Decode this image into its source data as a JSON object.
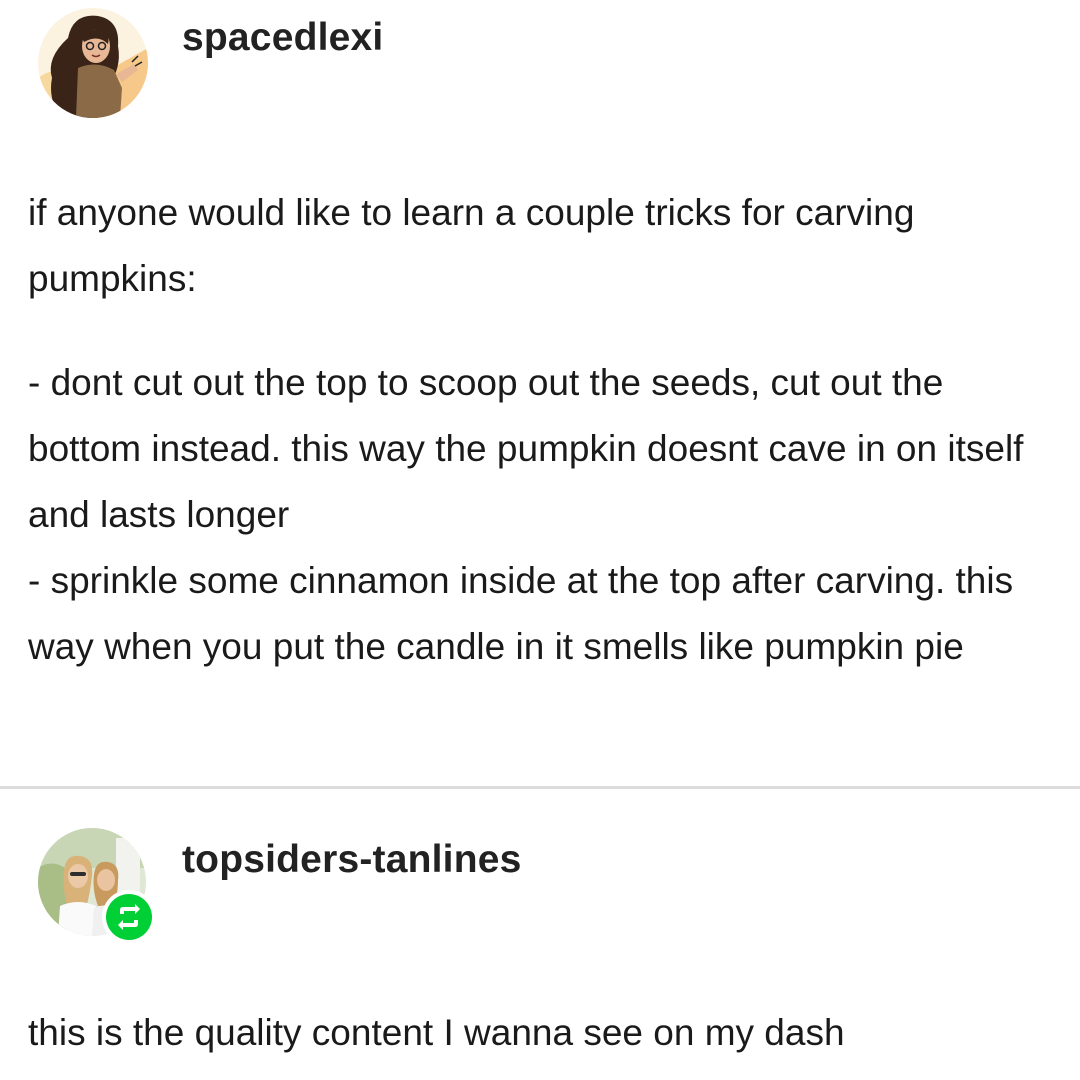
{
  "posts": [
    {
      "username": "spacedlexi",
      "avatar": "illustrated-woman-avatar",
      "intro": "if anyone would like to learn a couple tricks for carving pumpkins:",
      "tips": [
        "- dont cut out the top to scoop out the seeds, cut out the bottom instead. this way the pumpkin doesnt cave in on itself and lasts longer",
        "- sprinkle some cinnamon inside at the top after carving. this way when you put the candle in it smells like pumpkin pie"
      ]
    },
    {
      "username": "topsiders-tanlines",
      "avatar": "two-women-photo-avatar",
      "badge_icon": "reblog-icon",
      "body": "this is the quality content I wanna see on my dash"
    }
  ],
  "colors": {
    "reblog_green": "#00cf35",
    "divider": "#dcdcdc",
    "text": "#1a1a1a"
  }
}
